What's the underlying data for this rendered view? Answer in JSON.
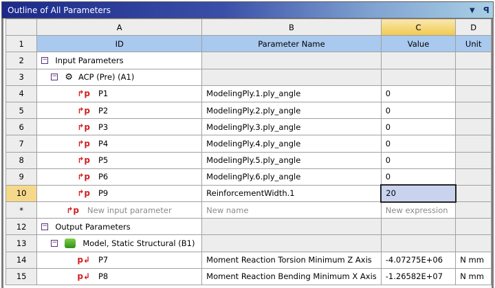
{
  "title": "Outline of All Parameters",
  "columns": {
    "letters": [
      "A",
      "B",
      "C",
      "D"
    ],
    "row1": [
      "ID",
      "Parameter Name",
      "Value",
      "Unit"
    ]
  },
  "rows": [
    {
      "num": "2",
      "id": "Input Parameters"
    },
    {
      "num": "3",
      "id": "ACP (Pre) (A1)"
    },
    {
      "num": "4",
      "id": "P1",
      "name": "ModelingPly.1.ply_angle",
      "value": "0"
    },
    {
      "num": "5",
      "id": "P2",
      "name": "ModelingPly.2.ply_angle",
      "value": "0"
    },
    {
      "num": "6",
      "id": "P3",
      "name": "ModelingPly.3.ply_angle",
      "value": "0"
    },
    {
      "num": "7",
      "id": "P4",
      "name": "ModelingPly.4.ply_angle",
      "value": "0"
    },
    {
      "num": "8",
      "id": "P5",
      "name": "ModelingPly.5.ply_angle",
      "value": "0"
    },
    {
      "num": "9",
      "id": "P6",
      "name": "ModelingPly.6.ply_angle",
      "value": "0"
    },
    {
      "num": "10",
      "id": "P9",
      "name": "ReinforcementWidth.1",
      "value": "20"
    },
    {
      "num": "*",
      "id": "New input parameter",
      "name": "New name",
      "value": "New expression"
    },
    {
      "num": "12",
      "id": "Output Parameters"
    },
    {
      "num": "13",
      "id": "Model, Static Structural (B1)"
    },
    {
      "num": "14",
      "id": "P7",
      "name": "Moment Reaction Torsion Minimum Z Axis",
      "value": "-4.07275E+06",
      "unit": "N mm"
    },
    {
      "num": "15",
      "id": "P8",
      "name": "Moment Reaction Bending Minimum X Axis",
      "value": "-1.26582E+07",
      "unit": "N mm"
    }
  ],
  "row1_num": "1"
}
